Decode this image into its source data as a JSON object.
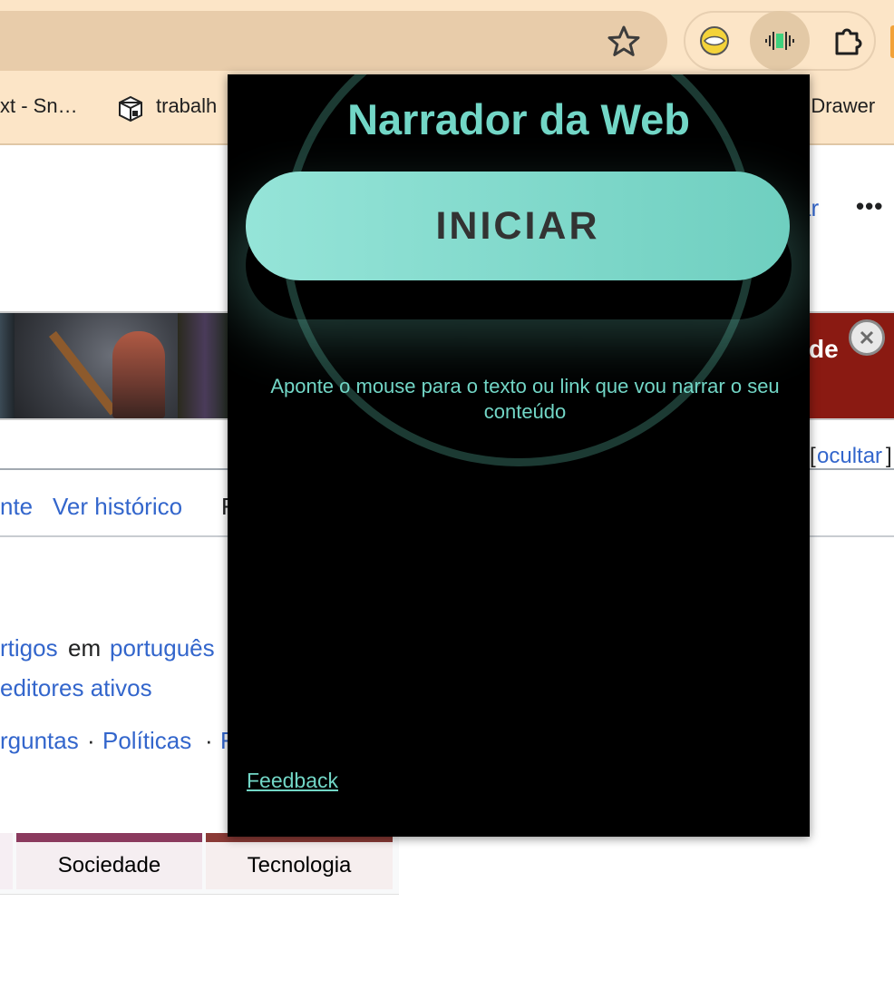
{
  "browser": {
    "bookmarks": [
      {
        "label": "xt - Sn…"
      },
      {
        "label": "trabalh"
      },
      {
        "label": "n Drawer"
      }
    ],
    "icons": {
      "star": "bookmark-star-icon",
      "ext1": "handshake-extension-icon",
      "ext2": "narrator-extension-icon",
      "ext3": "puzzle-extension-icon"
    }
  },
  "page": {
    "header_link": "ar",
    "more": "•••",
    "banner_text": "de",
    "hide_open": "[",
    "hide_link": "ocultar",
    "hide_close": "]",
    "tabs": {
      "tab_partial": "nte",
      "view_history": "Ver histórico",
      "tab_cut": "F"
    },
    "line1": {
      "a": "rtigos",
      "b": "em",
      "c": "português"
    },
    "line2": "editores ativos",
    "line3": {
      "a": "rguntas",
      "sep": "·",
      "b": "Políticas",
      "sep2": "·",
      "c": "F"
    },
    "categories": [
      {
        "label": "Sociedade",
        "color": "#8b3a5e"
      },
      {
        "label": "Tecnologia",
        "color": "#8b3a36"
      }
    ]
  },
  "popup": {
    "title": "Narrador da Web",
    "start_button": "INICIAR",
    "hint": "Aponte o mouse para o texto ou link que vou narrar o seu conteúdo",
    "feedback": "Feedback",
    "accent_color": "#72d6c6"
  }
}
